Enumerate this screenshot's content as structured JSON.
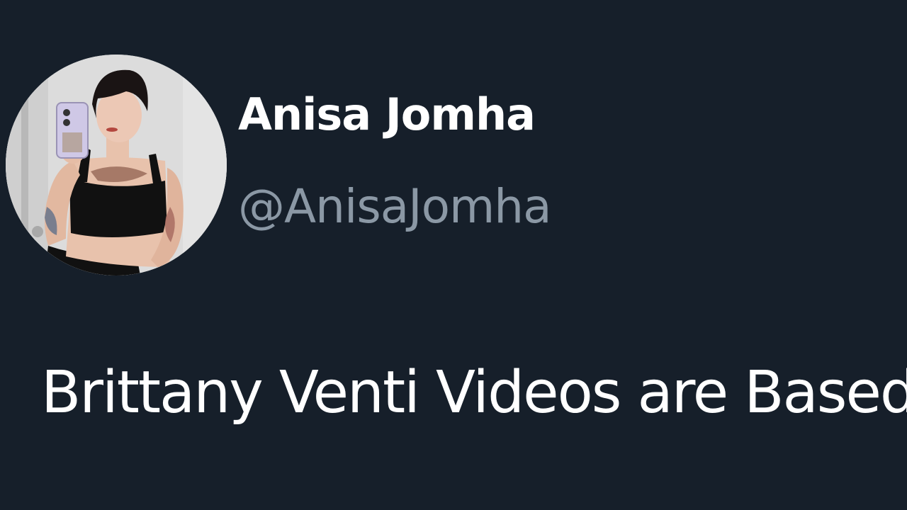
{
  "author": {
    "display_name": "Anisa Jomha",
    "handle": "@AnisaJomha",
    "avatar_icon": "profile-photo"
  },
  "tweet": {
    "text": "Brittany Venti Videos are Based"
  },
  "colors": {
    "background": "#161f2a",
    "display_name": "#ffffff",
    "handle": "#8b98a5",
    "text": "#ffffff"
  }
}
